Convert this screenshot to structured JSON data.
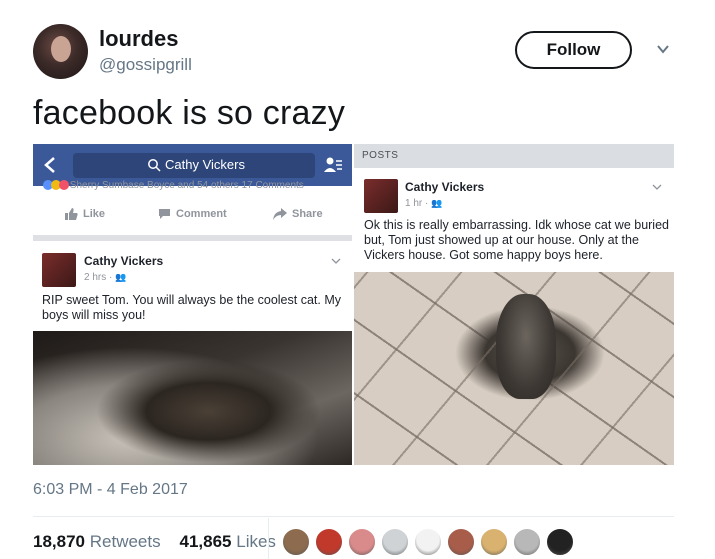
{
  "author": {
    "name": "lourdes",
    "handle": "@gossipgrill",
    "avatar_icon": "profile-photo"
  },
  "follow_label": "Follow",
  "tweet_text": "facebook is so crazy",
  "media": {
    "left_screenshot": {
      "search_text": "Cathy Vickers",
      "reaction_text": "Sherry Sumbase Boyce and 54 others   17 Comments",
      "actions": {
        "like": "Like",
        "comment": "Comment",
        "share": "Share"
      },
      "post": {
        "author": "Cathy Vickers",
        "time": "2 hrs ·",
        "text": "RIP sweet Tom.  You will always be the coolest cat. My boys will miss you!"
      }
    },
    "right_screenshot": {
      "header": "POSTS",
      "post": {
        "author": "Cathy Vickers",
        "time": "1 hr ·",
        "text": "Ok this is really embarrassing.  Idk whose cat we buried but, Tom just showed up at our house. Only at the Vickers house.  Got some happy boys here."
      }
    }
  },
  "timestamp": "6:03 PM - 4 Feb 2017",
  "stats": {
    "retweets_count": "18,870",
    "retweets_label": "Retweets",
    "likes_count": "41,865",
    "likes_label": "Likes"
  },
  "liker_colors": [
    "#8c6b4f",
    "#c0392b",
    "#d98a8a",
    "#cfd3d6",
    "#f2f2f2",
    "#a85d4a",
    "#d9b26f",
    "#b8b8b8",
    "#222222"
  ],
  "colors": {
    "facebook_blue": "#3b5998",
    "text_secondary": "#657786"
  }
}
